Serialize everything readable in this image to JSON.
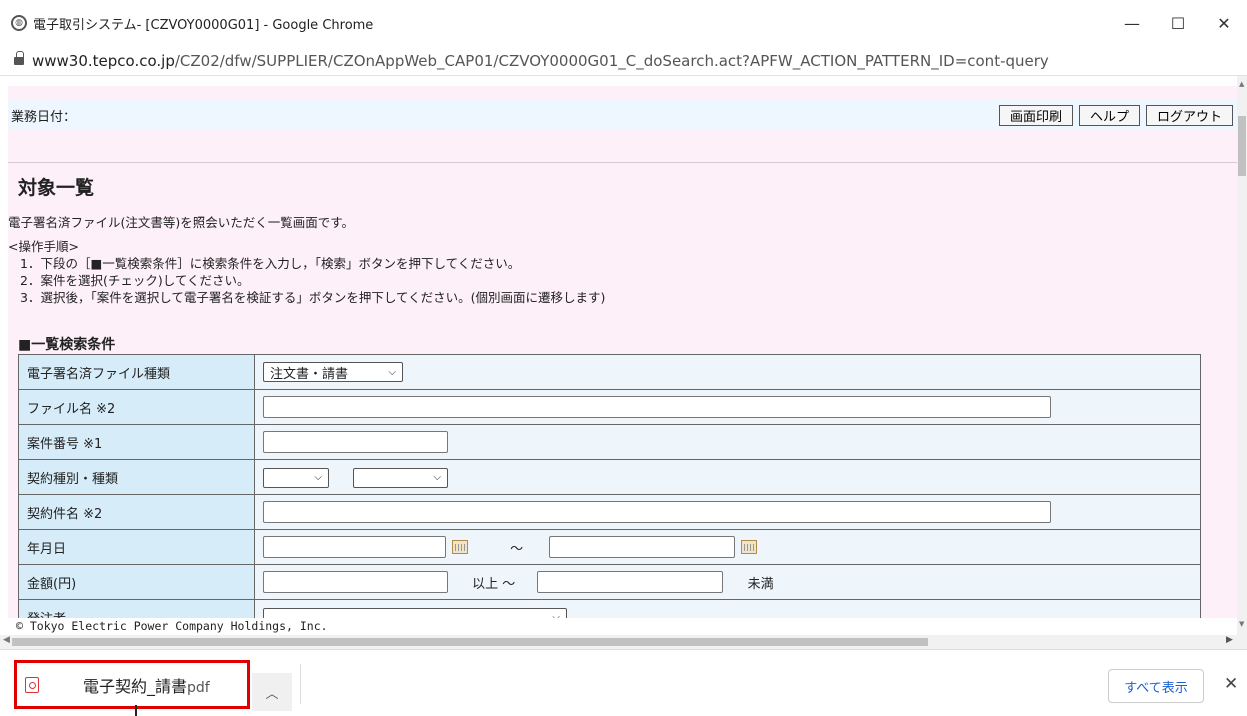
{
  "window": {
    "title": "電子取引システム- [CZVOY0000G01] - Google Chrome",
    "minimize": "—",
    "maximize": "☐",
    "close": "✕"
  },
  "address": {
    "host": "www30.tepco.co.jp",
    "path": "/CZ02/dfw/SUPPLIER/CZOnAppWeb_CAP01/CZVOY0000G01_C_doSearch.act?APFW_ACTION_PATTERN_ID=cont-query"
  },
  "header": {
    "business_date_label": "業務日付：",
    "buttons": {
      "print": "画面印刷",
      "help": "ヘルプ",
      "logout": "ログアウト"
    }
  },
  "main": {
    "title": "対象一覧",
    "description": "電子署名済ファイル(注文書等)を照会いただく一覧画面です。",
    "steps_heading": "<操作手順>",
    "steps": [
      "1．下段の［■一覧検索条件］に検索条件を入力し，「検索」ボタンを押下してください。",
      "2．案件を選択(チェック)してください。",
      "3．選択後，「案件を選択して電子署名を検証する」ボタンを押下してください。(個別画面に遷移します)"
    ],
    "search_section_title": "■一覧検索条件"
  },
  "form": {
    "file_type_label": "電子署名済ファイル種類",
    "file_type_value": "注文書・請書",
    "file_name_label": "ファイル名 ※2",
    "case_number_label": "案件番号 ※1",
    "contract_type_label": "契約種別・種類",
    "contract_name_label": "契約件名 ※2",
    "date_label": "年月日",
    "range_sep": "～",
    "amount_label": "金額(円)",
    "amount_min_suffix": "以上 ～",
    "amount_max_suffix": "未満",
    "orderer_label": "発注者"
  },
  "footer": {
    "copyright": "© Tokyo Electric Power Company Holdings, Inc."
  },
  "downloads": {
    "file_name": "電子契約_請書",
    "file_ext": "pdf",
    "show_all": "すべて表示",
    "close": "✕"
  }
}
